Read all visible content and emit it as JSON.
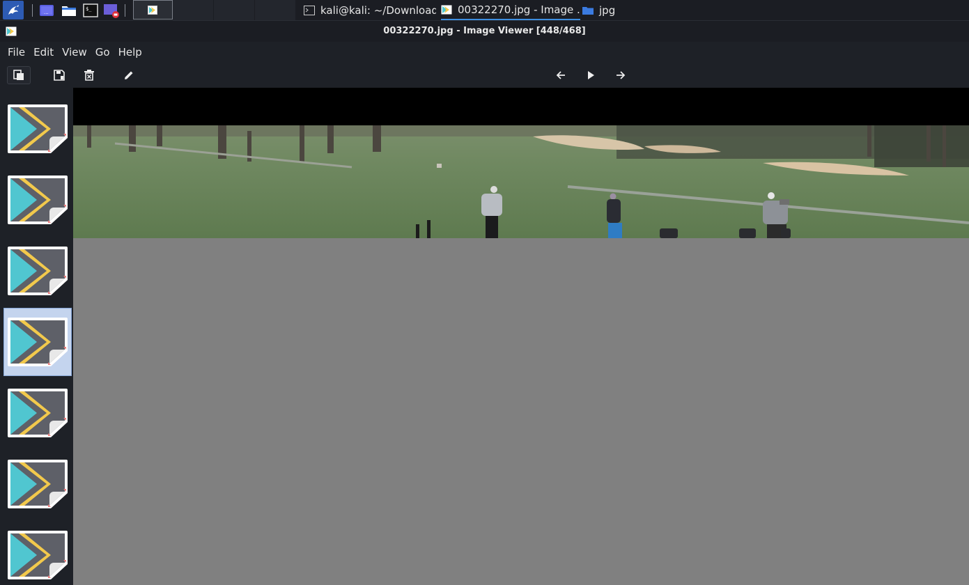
{
  "taskbar": {
    "tasks": [
      {
        "label": "kali@kali: ~/Downloads",
        "icon": "terminal-icon",
        "active": false
      },
      {
        "label": "00322270.jpg - Image ...",
        "icon": "image-viewer-icon",
        "active": true
      },
      {
        "label": "jpg",
        "icon": "folder-icon",
        "active": false
      }
    ]
  },
  "window": {
    "title": "00322270.jpg - Image Viewer [448/468]"
  },
  "menu": {
    "items": [
      "File",
      "Edit",
      "View",
      "Go",
      "Help"
    ]
  },
  "toolbar": {
    "tools": [
      "open-icon",
      "save-icon",
      "delete-icon",
      "edit-icon",
      "back-arrow-icon",
      "play-icon",
      "forward-arrow-icon"
    ]
  },
  "sidebar": {
    "thumbnail_count": 7,
    "selected_index": 3
  },
  "colors": {
    "taskbar_bg": "#1b1d23",
    "window_bg": "#1e2127",
    "viewer_bg": "#808080",
    "accent": "#3d8ee0",
    "selection": "#c4d4ee"
  }
}
